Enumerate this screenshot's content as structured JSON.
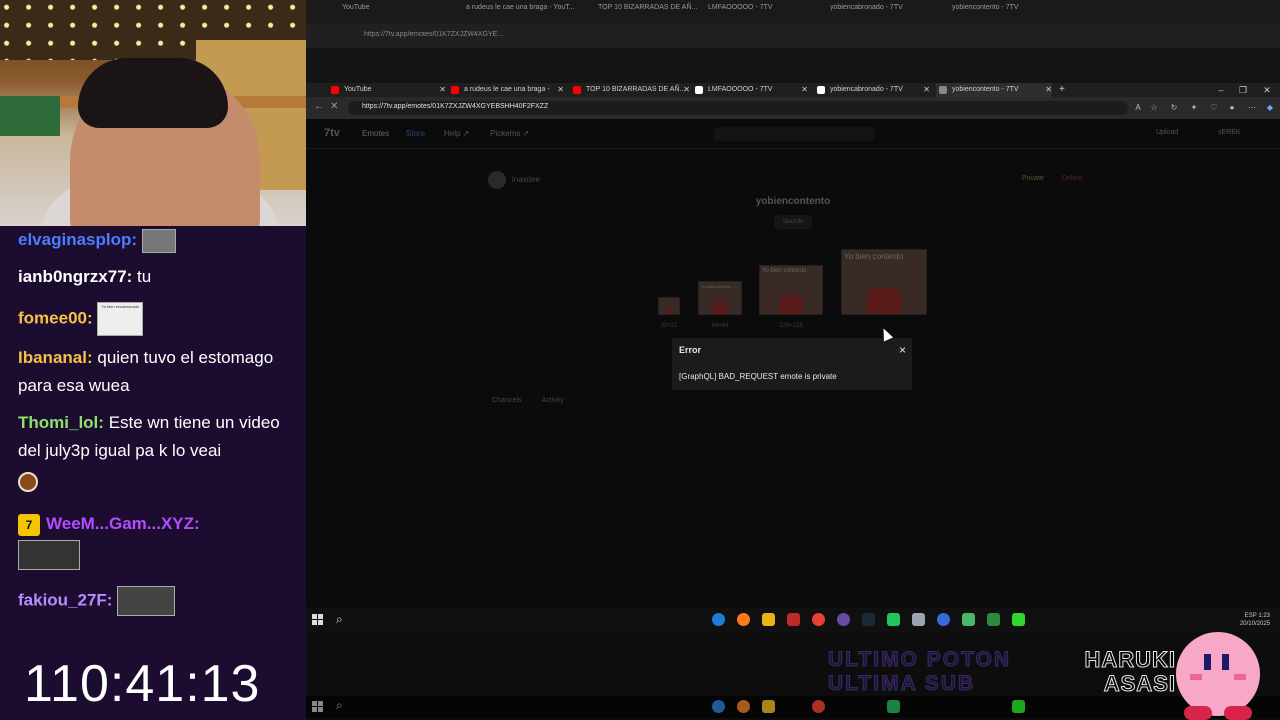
{
  "chat": {
    "messages": [
      {
        "user": "elvaginasplop:",
        "user_color": "#4a7dff",
        "text": ""
      },
      {
        "user": "ianb0ngrzx77:",
        "user_color": "#ffffff",
        "text": "tu"
      },
      {
        "user": "fomee00:",
        "user_color": "#f5c242",
        "text": ""
      },
      {
        "user": "Ibananal:",
        "user_color": "#f5c242",
        "text": "quien tuvo el estomago para esa wuea"
      },
      {
        "user": "Thomi_lol:",
        "user_color": "#8ce36a",
        "text": "Este wn tiene un video del july3p igual pa k lo veai"
      },
      {
        "user": "WeeM...Gam...XYZ:",
        "user_color": "#b44cff",
        "text": ""
      },
      {
        "user": "fakiou_27F:",
        "user_color": "#b78cff",
        "text": ""
      }
    ],
    "timer": "110:41:13",
    "sticker_caption": "Yo bien encabronado"
  },
  "ghost_browser": {
    "tabs": [
      "YouTube",
      "a rudeus le cae una braga - YouT...",
      "TOP 10 BIZARRADAS DE AÑ...",
      "LMFAOOOOO - 7TV",
      "yobiencabronado - 7TV",
      "yobiencontento - 7TV"
    ],
    "url": "https://7tv.app/emotes/01K7ZXJZW4XGYE..."
  },
  "browser": {
    "tabs": [
      {
        "label": "YouTube",
        "fav": "#ff0000"
      },
      {
        "label": "a rudeus le cae una braga - YouTu...",
        "fav": "#ff0000"
      },
      {
        "label": "TOP 10 BIZARRADAS DE AÑ...",
        "fav": "#ff0000"
      },
      {
        "label": "LMFAOOOOO - 7TV",
        "fav": "#ffffff"
      },
      {
        "label": "yobiencabronado - 7TV",
        "fav": "#ffffff"
      },
      {
        "label": "yobiencontento - 7TV",
        "fav": "#ffffff"
      }
    ],
    "new_tab": "+",
    "url": "https://7tv.app/emotes/01K7ZXJZW4XGYEBSHH40F2FXZZ"
  },
  "page7tv": {
    "logo": "7tv",
    "nav": [
      "Emotes",
      "Store",
      "Help ↗",
      "Pickems ↗"
    ],
    "upload": "Upload",
    "user": "sEREK",
    "owner": "inaxdee",
    "emote_name": "yobiencontento",
    "tag": "sbazulo",
    "actions": [
      "Private",
      "Delete"
    ],
    "sizes": [
      {
        "caption": "32×32",
        "label": ""
      },
      {
        "caption": "64×64",
        "label": "Yo bien contento"
      },
      {
        "caption": "128×128",
        "label": "Yo bien contento"
      },
      {
        "caption": "",
        "label": "Yo bien contento"
      }
    ],
    "lower_tabs": [
      "Channels",
      "Activity"
    ]
  },
  "modal": {
    "title": "Error",
    "message": "[GraphQL] BAD_REQUEST emote is private",
    "close": "×"
  },
  "taskbar": {
    "tray_lang": "ESP",
    "tray_time": "1:23",
    "tray_date": "20/10/2025"
  },
  "overlay": {
    "ultimo_line1": "ULTIMO POTON",
    "ultimo_line2": "ULTIMA SUB",
    "haruki_line1": "HARUKI",
    "haruki_line2": "ASASI"
  }
}
